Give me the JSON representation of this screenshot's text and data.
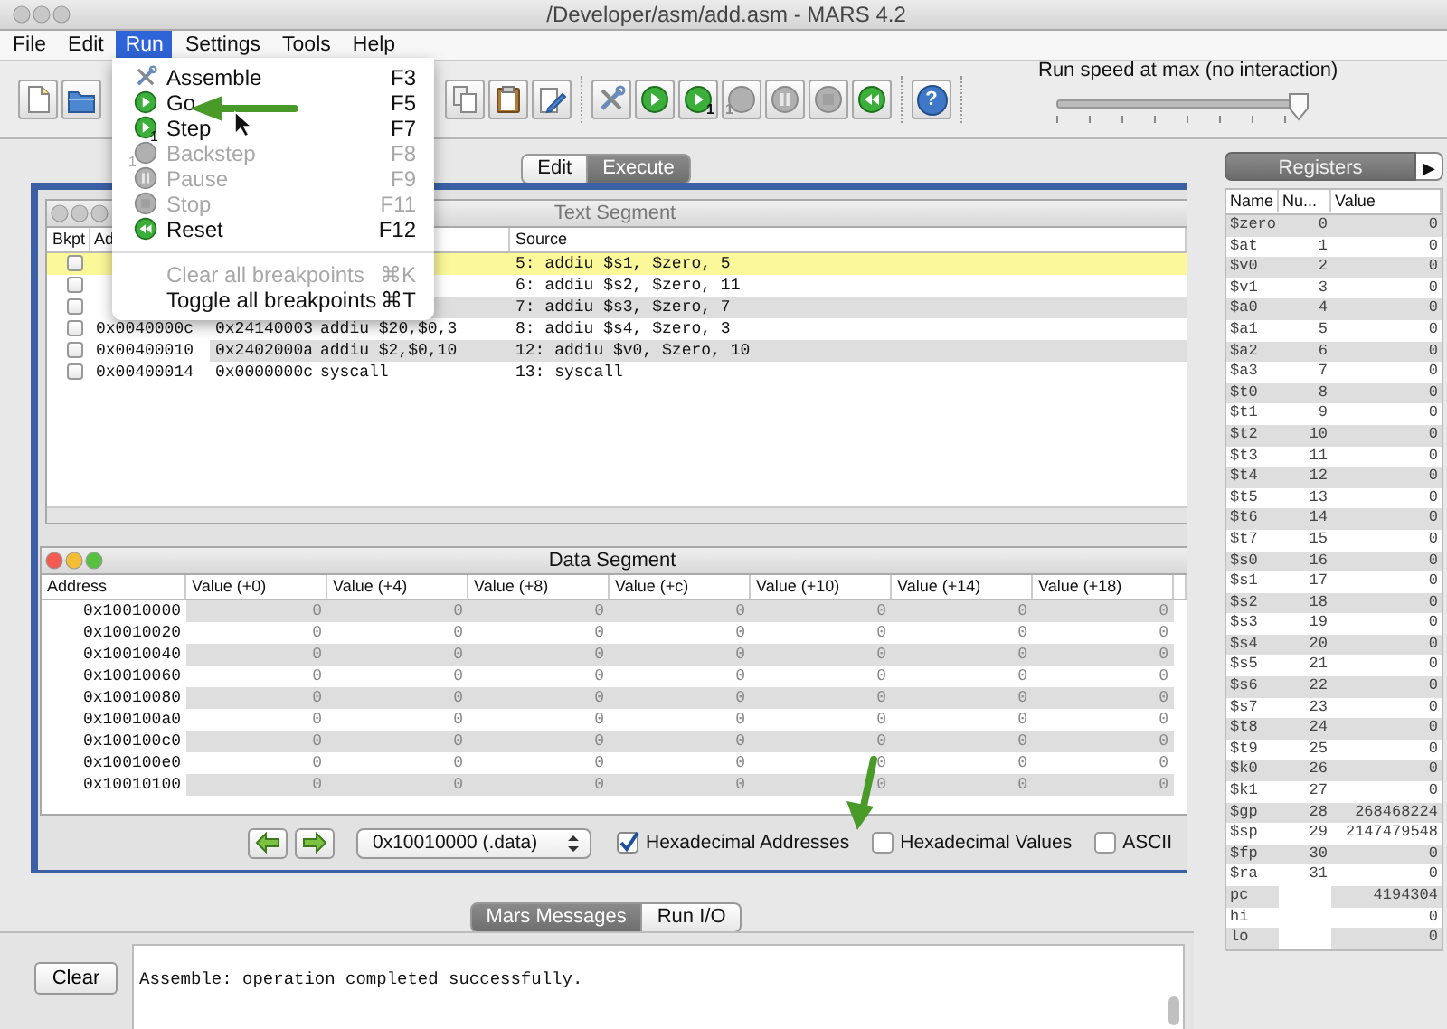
{
  "window": {
    "title": "/Developer/asm/add.asm  - MARS 4.2"
  },
  "menus": [
    {
      "label": "File",
      "selected": false
    },
    {
      "label": "Edit",
      "selected": false
    },
    {
      "label": "Run",
      "selected": true
    },
    {
      "label": "Settings",
      "selected": false
    },
    {
      "label": "Tools",
      "selected": false
    },
    {
      "label": "Help",
      "selected": false
    }
  ],
  "run_menu": {
    "items": [
      {
        "kind": "assemble",
        "label": "Assemble",
        "shortcut": "F3",
        "disabled": false
      },
      {
        "kind": "go",
        "label": "Go",
        "shortcut": "F5",
        "disabled": false
      },
      {
        "kind": "step",
        "label": "Step",
        "badge": "1",
        "shortcut": "F7",
        "disabled": false
      },
      {
        "kind": "backstep",
        "label": "Backstep",
        "badge": "1",
        "shortcut": "F8",
        "disabled": true
      },
      {
        "kind": "pause",
        "label": "Pause",
        "shortcut": "F9",
        "disabled": true
      },
      {
        "kind": "stop",
        "label": "Stop",
        "shortcut": "F11",
        "disabled": true
      },
      {
        "kind": "reset",
        "label": "Reset",
        "shortcut": "F12",
        "disabled": false
      },
      {
        "kind": "separator"
      },
      {
        "kind": "plain",
        "label": "Clear all breakpoints",
        "shortcut": "⌘K",
        "disabled": true
      },
      {
        "kind": "plain",
        "label": "Toggle all breakpoints",
        "shortcut": "⌘T",
        "disabled": false
      }
    ]
  },
  "toolbar": {
    "file_group": [
      {
        "kind": "new"
      },
      {
        "kind": "open"
      }
    ],
    "edit_group": [
      {
        "kind": "copy"
      },
      {
        "kind": "paste"
      },
      {
        "kind": "edit"
      }
    ],
    "run_group": [
      {
        "kind": "assemble",
        "disabled": false
      },
      {
        "kind": "go",
        "disabled": false
      },
      {
        "kind": "step",
        "badge": "1",
        "disabled": false
      },
      {
        "kind": "backstep",
        "badge": "1",
        "disabled": true
      },
      {
        "kind": "pause",
        "disabled": true
      },
      {
        "kind": "stop",
        "disabled": true
      },
      {
        "kind": "reset",
        "disabled": false
      }
    ],
    "help": {
      "label": "?"
    }
  },
  "run_speed": {
    "label": "Run speed at max (no interaction)",
    "level": 1
  },
  "view_tabs": [
    {
      "label": "Edit",
      "selected": false
    },
    {
      "label": "Execute",
      "selected": true
    }
  ],
  "text_segment": {
    "title": "Text Segment",
    "columns": {
      "breakpoint": "Bkpt",
      "address": "Ad",
      "source": "Source"
    },
    "rows": [
      {
        "breakpoint": false,
        "selected": true,
        "source": "5: addiu $s1, $zero, 5"
      },
      {
        "breakpoint": false,
        "selected": false,
        "source": "6: addiu $s2, $zero, 11"
      },
      {
        "breakpoint": false,
        "selected": false,
        "source": "7: addiu $s3, $zero, 7"
      },
      {
        "breakpoint": false,
        "selected": false,
        "address": "0x0040000c",
        "code": "0x24140003",
        "basic": "addiu $20,$0,3",
        "source": "8: addiu $s4, $zero, 3"
      },
      {
        "breakpoint": false,
        "selected": false,
        "address": "0x00400010",
        "code": "0x2402000a",
        "basic": "addiu $2,$0,10",
        "source": "12: addiu $v0, $zero, 10"
      },
      {
        "breakpoint": false,
        "selected": false,
        "address": "0x00400014",
        "code": "0x0000000c",
        "basic": "syscall",
        "source": "13: syscall"
      }
    ]
  },
  "data_segment": {
    "title": "Data Segment",
    "columns": [
      "Address",
      "Value (+0)",
      "Value (+4)",
      "Value (+8)",
      "Value (+c)",
      "Value (+10)",
      "Value (+14)",
      "Value (+18)"
    ],
    "rows": [
      {
        "address": "0x10010000",
        "values": [
          "0",
          "0",
          "0",
          "0",
          "0",
          "0",
          "0"
        ]
      },
      {
        "address": "0x10010020",
        "values": [
          "0",
          "0",
          "0",
          "0",
          "0",
          "0",
          "0"
        ]
      },
      {
        "address": "0x10010040",
        "values": [
          "0",
          "0",
          "0",
          "0",
          "0",
          "0",
          "0"
        ]
      },
      {
        "address": "0x10010060",
        "values": [
          "0",
          "0",
          "0",
          "0",
          "0",
          "0",
          "0"
        ]
      },
      {
        "address": "0x10010080",
        "values": [
          "0",
          "0",
          "0",
          "0",
          "0",
          "0",
          "0"
        ]
      },
      {
        "address": "0x100100a0",
        "values": [
          "0",
          "0",
          "0",
          "0",
          "0",
          "0",
          "0"
        ]
      },
      {
        "address": "0x100100c0",
        "values": [
          "0",
          "0",
          "0",
          "0",
          "0",
          "0",
          "0"
        ]
      },
      {
        "address": "0x100100e0",
        "values": [
          "0",
          "0",
          "0",
          "0",
          "0",
          "0",
          "0"
        ]
      },
      {
        "address": "0x10010100",
        "values": [
          "0",
          "0",
          "0",
          "0",
          "0",
          "0",
          "0"
        ]
      }
    ],
    "address_field": "0x10010000 (.data)",
    "options": [
      {
        "label": "Hexadecimal Addresses",
        "checked": true
      },
      {
        "label": "Hexadecimal Values",
        "checked": false
      },
      {
        "label": "ASCII",
        "checked": false
      }
    ]
  },
  "messages": {
    "tabs": [
      {
        "label": "Mars Messages",
        "selected": true
      },
      {
        "label": "Run I/O",
        "selected": false
      }
    ],
    "clear_button": "Clear",
    "text": "Assemble: operation completed successfully."
  },
  "registers": {
    "title": "Registers",
    "expand_button": "▶",
    "columns": [
      "Name",
      "Nu...",
      "Value"
    ],
    "rows": [
      {
        "name": "$zero",
        "number": "0",
        "value": "0"
      },
      {
        "name": "$at",
        "number": "1",
        "value": "0"
      },
      {
        "name": "$v0",
        "number": "2",
        "value": "0"
      },
      {
        "name": "$v1",
        "number": "3",
        "value": "0"
      },
      {
        "name": "$a0",
        "number": "4",
        "value": "0"
      },
      {
        "name": "$a1",
        "number": "5",
        "value": "0"
      },
      {
        "name": "$a2",
        "number": "6",
        "value": "0"
      },
      {
        "name": "$a3",
        "number": "7",
        "value": "0"
      },
      {
        "name": "$t0",
        "number": "8",
        "value": "0"
      },
      {
        "name": "$t1",
        "number": "9",
        "value": "0"
      },
      {
        "name": "$t2",
        "number": "10",
        "value": "0"
      },
      {
        "name": "$t3",
        "number": "11",
        "value": "0"
      },
      {
        "name": "$t4",
        "number": "12",
        "value": "0"
      },
      {
        "name": "$t5",
        "number": "13",
        "value": "0"
      },
      {
        "name": "$t6",
        "number": "14",
        "value": "0"
      },
      {
        "name": "$t7",
        "number": "15",
        "value": "0"
      },
      {
        "name": "$s0",
        "number": "16",
        "value": "0"
      },
      {
        "name": "$s1",
        "number": "17",
        "value": "0"
      },
      {
        "name": "$s2",
        "number": "18",
        "value": "0"
      },
      {
        "name": "$s3",
        "number": "19",
        "value": "0"
      },
      {
        "name": "$s4",
        "number": "20",
        "value": "0"
      },
      {
        "name": "$s5",
        "number": "21",
        "value": "0"
      },
      {
        "name": "$s6",
        "number": "22",
        "value": "0"
      },
      {
        "name": "$s7",
        "number": "23",
        "value": "0"
      },
      {
        "name": "$t8",
        "number": "24",
        "value": "0"
      },
      {
        "name": "$t9",
        "number": "25",
        "value": "0"
      },
      {
        "name": "$k0",
        "number": "26",
        "value": "0"
      },
      {
        "name": "$k1",
        "number": "27",
        "value": "0"
      },
      {
        "name": "$gp",
        "number": "28",
        "value": "268468224"
      },
      {
        "name": "$sp",
        "number": "29",
        "value": "2147479548"
      },
      {
        "name": "$fp",
        "number": "30",
        "value": "0"
      },
      {
        "name": "$ra",
        "number": "31",
        "value": "0"
      },
      {
        "name": "pc",
        "value": "4194304"
      },
      {
        "name": "hi",
        "value": "0"
      },
      {
        "name": "lo",
        "value": "0"
      }
    ]
  }
}
